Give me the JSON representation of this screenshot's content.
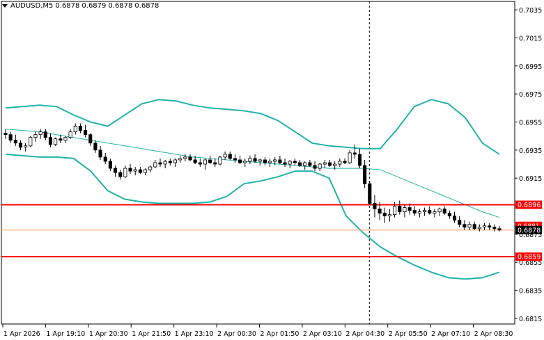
{
  "header": {
    "symbol": "AUDUSD,M5",
    "open": "0.6878",
    "high": "0.6879",
    "low": "0.6878",
    "close": "0.6878"
  },
  "colors": {
    "background": "#ffffff",
    "candle_up_body": "#ffffff",
    "candle_down_body": "#000000",
    "candle_outline": "#000000",
    "bollinger_band": "#20b2aa",
    "bollinger_mid": "#20b2aa",
    "level_line": "#ff0000",
    "current_price_line": "#f4a460",
    "grid_text": "#000000"
  },
  "chart_data": {
    "type": "candlestick",
    "symbol": "AUDUSD",
    "timeframe": "M5",
    "ylim": [
      0.6811,
      0.7041
    ],
    "y_ticks": [
      "0.7035",
      "0.7015",
      "0.6995",
      "0.6975",
      "0.6955",
      "0.6935",
      "0.6915",
      "0.6895",
      "0.6875",
      "0.6855",
      "0.6835",
      "0.6815"
    ],
    "x_ticks": [
      "1 Apr 2026",
      "1 Apr 19:10",
      "1 Apr 20:30",
      "1 Apr 21:50",
      "1 Apr 23:10",
      "2 Apr 00:30",
      "2 Apr 01:50",
      "2 Apr 03:10",
      "2 Apr 04:30",
      "2 Apr 05:50",
      "2 Apr 07:10",
      "2 Apr 08:30"
    ],
    "horizontal_levels": [
      {
        "price": 0.6896,
        "label": "0.6896",
        "color": "#ff0000"
      },
      {
        "price": 0.6859,
        "label": "0.6859",
        "color": "#ff0000"
      }
    ],
    "current_price": {
      "price": 0.6878,
      "label": "0.6878"
    },
    "ask_price": {
      "price": 0.6881,
      "label": "0.6881"
    },
    "vertical_marker_index": 73,
    "bollinger": {
      "upper": [
        0.6965,
        0.6966,
        0.6967,
        0.6966,
        0.696,
        0.6955,
        0.6952,
        0.696,
        0.6968,
        0.6971,
        0.697,
        0.6967,
        0.6965,
        0.6964,
        0.6963,
        0.6961,
        0.6956,
        0.6948,
        0.694,
        0.6938,
        0.6937,
        0.6936,
        0.6936,
        0.695,
        0.6966,
        0.6971,
        0.6968,
        0.6958,
        0.694,
        0.6932
      ],
      "middle": [
        0.695,
        0.6949,
        0.6948,
        0.6946,
        0.6944,
        0.6942,
        0.694,
        0.6938,
        0.6936,
        0.6934,
        0.6932,
        0.693,
        0.6929,
        0.6928,
        0.6927,
        0.6926,
        0.6925,
        0.6924,
        0.6923,
        0.6922,
        0.6922,
        0.6922,
        0.6921,
        0.6916,
        0.6911,
        0.6906,
        0.6901,
        0.6896,
        0.6891,
        0.6887
      ],
      "lower": [
        0.6932,
        0.6931,
        0.693,
        0.693,
        0.6929,
        0.692,
        0.6906,
        0.69,
        0.6898,
        0.6897,
        0.6897,
        0.6897,
        0.6898,
        0.6902,
        0.6911,
        0.6913,
        0.6916,
        0.692,
        0.692,
        0.6915,
        0.6888,
        0.6876,
        0.6866,
        0.6859,
        0.6853,
        0.6848,
        0.6844,
        0.6843,
        0.6844,
        0.6848
      ]
    },
    "candles": [
      [
        0.6947,
        0.695,
        0.6943,
        0.6946
      ],
      [
        0.6946,
        0.6948,
        0.694,
        0.6942
      ],
      [
        0.6942,
        0.6946,
        0.6938,
        0.694
      ],
      [
        0.694,
        0.6942,
        0.6935,
        0.6937
      ],
      [
        0.6937,
        0.694,
        0.6934,
        0.6938
      ],
      [
        0.6938,
        0.6945,
        0.6937,
        0.6944
      ],
      [
        0.6944,
        0.6948,
        0.6941,
        0.6946
      ],
      [
        0.6946,
        0.695,
        0.6943,
        0.6948
      ],
      [
        0.6948,
        0.695,
        0.6942,
        0.6944
      ],
      [
        0.6944,
        0.6947,
        0.6937,
        0.6939
      ],
      [
        0.6939,
        0.6944,
        0.6938,
        0.6943
      ],
      [
        0.6943,
        0.6946,
        0.694,
        0.6942
      ],
      [
        0.6942,
        0.6945,
        0.694,
        0.6944
      ],
      [
        0.6944,
        0.695,
        0.6943,
        0.6948
      ],
      [
        0.6948,
        0.6954,
        0.6946,
        0.6952
      ],
      [
        0.6952,
        0.6954,
        0.6947,
        0.6949
      ],
      [
        0.6949,
        0.6953,
        0.6944,
        0.6946
      ],
      [
        0.6946,
        0.6947,
        0.6938,
        0.694
      ],
      [
        0.694,
        0.6942,
        0.6933,
        0.6935
      ],
      [
        0.6935,
        0.6938,
        0.6928,
        0.693
      ],
      [
        0.693,
        0.6933,
        0.6925,
        0.6927
      ],
      [
        0.6927,
        0.6929,
        0.692,
        0.6922
      ],
      [
        0.6922,
        0.6924,
        0.6916,
        0.6919
      ],
      [
        0.6919,
        0.6921,
        0.6914,
        0.6916
      ],
      [
        0.6916,
        0.6924,
        0.6915,
        0.6922
      ],
      [
        0.6922,
        0.6925,
        0.6918,
        0.692
      ],
      [
        0.692,
        0.6923,
        0.6917,
        0.6921
      ],
      [
        0.6921,
        0.6923,
        0.6918,
        0.6919
      ],
      [
        0.6919,
        0.6922,
        0.6917,
        0.6921
      ],
      [
        0.6921,
        0.6924,
        0.6919,
        0.6923
      ],
      [
        0.6923,
        0.6928,
        0.6922,
        0.6926
      ],
      [
        0.6926,
        0.6929,
        0.6923,
        0.6925
      ],
      [
        0.6925,
        0.6928,
        0.6922,
        0.6927
      ],
      [
        0.6927,
        0.6929,
        0.6924,
        0.6926
      ],
      [
        0.6926,
        0.6929,
        0.6923,
        0.6928
      ],
      [
        0.6928,
        0.6931,
        0.6926,
        0.6929
      ],
      [
        0.6929,
        0.6932,
        0.6927,
        0.693
      ],
      [
        0.693,
        0.6932,
        0.6927,
        0.6928
      ],
      [
        0.6928,
        0.6931,
        0.6925,
        0.6926
      ],
      [
        0.6926,
        0.6929,
        0.6923,
        0.6925
      ],
      [
        0.6925,
        0.6929,
        0.6921,
        0.6928
      ],
      [
        0.6928,
        0.6931,
        0.6925,
        0.6926
      ],
      [
        0.6926,
        0.6929,
        0.6923,
        0.6925
      ],
      [
        0.6925,
        0.6931,
        0.6924,
        0.693
      ],
      [
        0.693,
        0.6934,
        0.6928,
        0.6932
      ],
      [
        0.6932,
        0.6934,
        0.6928,
        0.6929
      ],
      [
        0.6929,
        0.6932,
        0.6926,
        0.6928
      ],
      [
        0.6928,
        0.6931,
        0.6925,
        0.6926
      ],
      [
        0.6926,
        0.6929,
        0.6923,
        0.6927
      ],
      [
        0.6927,
        0.6931,
        0.6925,
        0.6929
      ],
      [
        0.6929,
        0.6932,
        0.6926,
        0.6927
      ],
      [
        0.6927,
        0.6929,
        0.6924,
        0.6928
      ],
      [
        0.6928,
        0.693,
        0.6924,
        0.6926
      ],
      [
        0.6926,
        0.6929,
        0.6923,
        0.6927
      ],
      [
        0.6927,
        0.693,
        0.6924,
        0.6928
      ],
      [
        0.6928,
        0.6931,
        0.6925,
        0.6926
      ],
      [
        0.6926,
        0.6929,
        0.6923,
        0.6925
      ],
      [
        0.6925,
        0.6928,
        0.6922,
        0.6927
      ],
      [
        0.6927,
        0.6929,
        0.6924,
        0.6926
      ],
      [
        0.6926,
        0.6928,
        0.6923,
        0.6924
      ],
      [
        0.6924,
        0.6927,
        0.6921,
        0.6926
      ],
      [
        0.6926,
        0.6928,
        0.6923,
        0.6924
      ],
      [
        0.6924,
        0.6927,
        0.692,
        0.6922
      ],
      [
        0.6922,
        0.6926,
        0.692,
        0.6925
      ],
      [
        0.6925,
        0.6928,
        0.6922,
        0.6926
      ],
      [
        0.6926,
        0.6928,
        0.6923,
        0.6924
      ],
      [
        0.6924,
        0.6927,
        0.6921,
        0.6925
      ],
      [
        0.6925,
        0.6929,
        0.6923,
        0.6927
      ],
      [
        0.6927,
        0.6929,
        0.6925,
        0.6926
      ],
      [
        0.6926,
        0.6935,
        0.6925,
        0.6933
      ],
      [
        0.6933,
        0.6939,
        0.6929,
        0.6932
      ],
      [
        0.6932,
        0.6936,
        0.6922,
        0.6924
      ],
      [
        0.6924,
        0.6928,
        0.6908,
        0.6911
      ],
      [
        0.6911,
        0.6913,
        0.6896,
        0.6897
      ],
      [
        0.6897,
        0.6903,
        0.6887,
        0.6893
      ],
      [
        0.6893,
        0.6898,
        0.6885,
        0.689
      ],
      [
        0.689,
        0.6894,
        0.6883,
        0.6888
      ],
      [
        0.6888,
        0.6893,
        0.6884,
        0.6889
      ],
      [
        0.6889,
        0.6898,
        0.6887,
        0.6895
      ],
      [
        0.6895,
        0.6899,
        0.6889,
        0.6891
      ],
      [
        0.6891,
        0.6896,
        0.6887,
        0.6894
      ],
      [
        0.6894,
        0.6897,
        0.6889,
        0.6892
      ],
      [
        0.6892,
        0.6895,
        0.6888,
        0.689
      ],
      [
        0.689,
        0.6893,
        0.6887,
        0.6891
      ],
      [
        0.6891,
        0.6894,
        0.6888,
        0.6892
      ],
      [
        0.6892,
        0.6895,
        0.6889,
        0.689
      ],
      [
        0.689,
        0.6893,
        0.6887,
        0.6891
      ],
      [
        0.6891,
        0.6894,
        0.6888,
        0.6893
      ],
      [
        0.6893,
        0.6895,
        0.6889,
        0.689
      ],
      [
        0.689,
        0.6892,
        0.6886,
        0.6888
      ],
      [
        0.6888,
        0.6891,
        0.6883,
        0.6885
      ],
      [
        0.6885,
        0.6888,
        0.688,
        0.6882
      ],
      [
        0.6882,
        0.6885,
        0.6878,
        0.688
      ],
      [
        0.688,
        0.6884,
        0.6878,
        0.6882
      ],
      [
        0.6882,
        0.6884,
        0.6878,
        0.6879
      ],
      [
        0.6879,
        0.6882,
        0.6877,
        0.688
      ],
      [
        0.688,
        0.6883,
        0.6878,
        0.6881
      ],
      [
        0.6881,
        0.6883,
        0.6878,
        0.688
      ],
      [
        0.688,
        0.6882,
        0.6877,
        0.6879
      ],
      [
        0.6879,
        0.6881,
        0.6877,
        0.6878
      ]
    ]
  }
}
